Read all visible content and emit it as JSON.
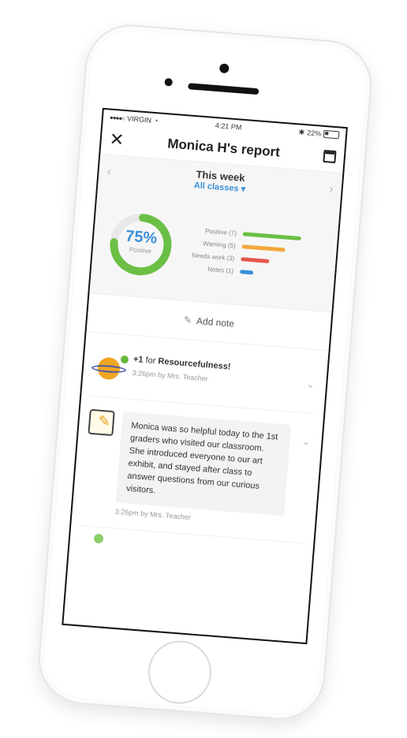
{
  "status_bar": {
    "carrier": "VIRGIN",
    "time": "4:21 PM",
    "battery": "22%"
  },
  "header": {
    "title": "Monica H's report"
  },
  "period": {
    "week": "This week",
    "classes": "All classes"
  },
  "summary": {
    "percent": "75%",
    "percent_label": "Positive",
    "positive_fraction": 0.75,
    "legend": [
      {
        "label": "Positive (7)",
        "count": 7,
        "color": "#6bbf45"
      },
      {
        "label": "Warning (5)",
        "count": 5,
        "color": "#f2a93b"
      },
      {
        "label": "Needs work (3)",
        "count": 3,
        "color": "#e6584f"
      },
      {
        "label": "Notes (1)",
        "count": 1,
        "color": "#3b8fd8"
      }
    ]
  },
  "actions": {
    "add_note": "Add note"
  },
  "feed": [
    {
      "prefix": "+1",
      "for_text": "for",
      "skill": "Resourcefulness!",
      "time": "3:26pm by Mrs. Teacher"
    },
    {
      "note": "Monica was so helpful today to the 1st graders who visited our classroom. She introduced everyone to our art exhibit, and stayed after class to answer questions from our curious visitors.",
      "time": "3:26pm by Mrs. Teacher"
    }
  ],
  "icons": {
    "close": "close-icon",
    "calendar": "calendar-icon",
    "prev": "chevron-left-icon",
    "next": "chevron-right-icon",
    "edit": "pencil-icon",
    "expand": "chevron-down-icon"
  }
}
